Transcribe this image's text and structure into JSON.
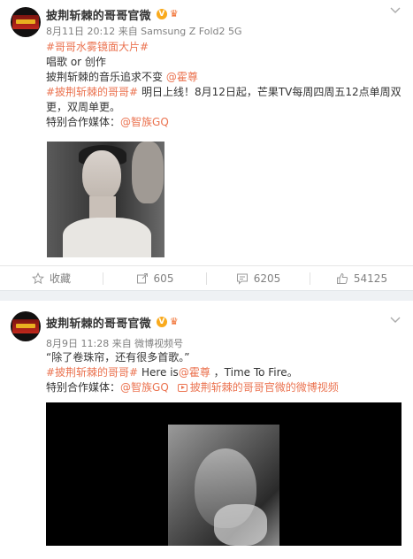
{
  "posts": [
    {
      "author": "披荆斩棘的哥哥官微",
      "meta": "8月11日 20:12 来自 Samsung Z Fold2 5G",
      "lines": {
        "l1": "#哥哥水雾镜面大片#",
        "l2": "唱歌 or 创作",
        "l3_text": "披荆斩棘的音乐追求不变 ",
        "l3_mention": "@霍尊",
        "l4_tag": "#披荆斩棘的哥哥#",
        "l4_text": " 明日上线！8月12日起，芒果TV每周四周五12点单周双",
        "l5": "更，双周单更。",
        "l6_text": "特别合作媒体：",
        "l6_mention": "@智族GQ"
      },
      "actions": {
        "favorite": "收藏",
        "repost": "605",
        "comment": "6205",
        "like": "54125"
      }
    },
    {
      "author": "披荆斩棘的哥哥官微",
      "meta": "8月9日 11:28 来自 微博视频号",
      "lines": {
        "l1": "“除了卷珠帘，还有很多首歌。”",
        "l2_tag": "#披荆斩棘的哥哥#",
        "l2_text1": " Here is",
        "l2_mention": "@霍尊",
        "l2_text2": " ，Time To Fire。",
        "l3_text": "特别合作媒体：",
        "l3_mention": "@智族GQ",
        "l3_video": "披荆斩棘的哥哥官微的微博视频"
      }
    }
  ],
  "colors": {
    "link": "#eb7350",
    "vip": "#f9aa1d",
    "text": "#333333",
    "meta": "#808080"
  },
  "icons": {
    "verified": "verified-badge-icon",
    "crown": "crown-icon",
    "chevron": "chevron-down-icon",
    "favorite": "star-icon",
    "repost": "repost-icon",
    "comment": "comment-icon",
    "like": "thumbs-up-icon",
    "video": "video-link-icon"
  }
}
